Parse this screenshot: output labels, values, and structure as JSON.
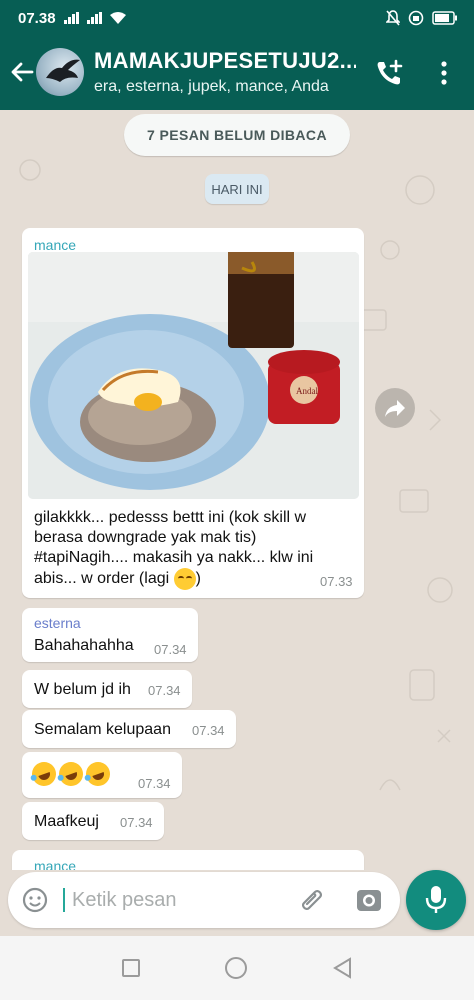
{
  "status_bar": {
    "time": "07.38"
  },
  "header": {
    "title": "MAMAKJUPESETUJU2...",
    "participants": "era, esterna, jupek, mance, Anda"
  },
  "chat": {
    "unread_banner": "7 PESAN BELUM DIBACA",
    "date_divider": "HARI INI",
    "messages": [
      {
        "sender": "mance",
        "sender_color": "#35a7b8",
        "has_image": true,
        "image_description_icon": "food-photo",
        "text": "gilakkkk... pedesss bettt ini (kok skill w berasa downgrade yak mak tis) #tapiNagih.... makasih ya nakk... klw ini abis... w order (lagi ",
        "text_suffix": ")",
        "emoji_icon": "smirk-emoji-icon",
        "time": "07.33"
      },
      {
        "sender": "esterna",
        "sender_color": "#6a7ecb",
        "text": "Bahahahahha",
        "time": "07.34"
      },
      {
        "text": "W belum jd ih",
        "time": "07.34"
      },
      {
        "text": "Semalam kelupaan",
        "time": "07.34"
      },
      {
        "emoji_icon": "rolling-laughing-emoji-icon",
        "emoji_count": 3,
        "time": "07.34"
      },
      {
        "text": "Maafkeuj",
        "time": "07.34"
      },
      {
        "sender": "mance",
        "sender_color": "#35a7b8",
        "partial": true
      }
    ]
  },
  "composer": {
    "placeholder": "Ketik pesan",
    "value": ""
  },
  "colors": {
    "primary": "#075e54",
    "accent": "#128c7e",
    "chat_background": "#e5ddd5",
    "bubble": "#ffffff"
  }
}
